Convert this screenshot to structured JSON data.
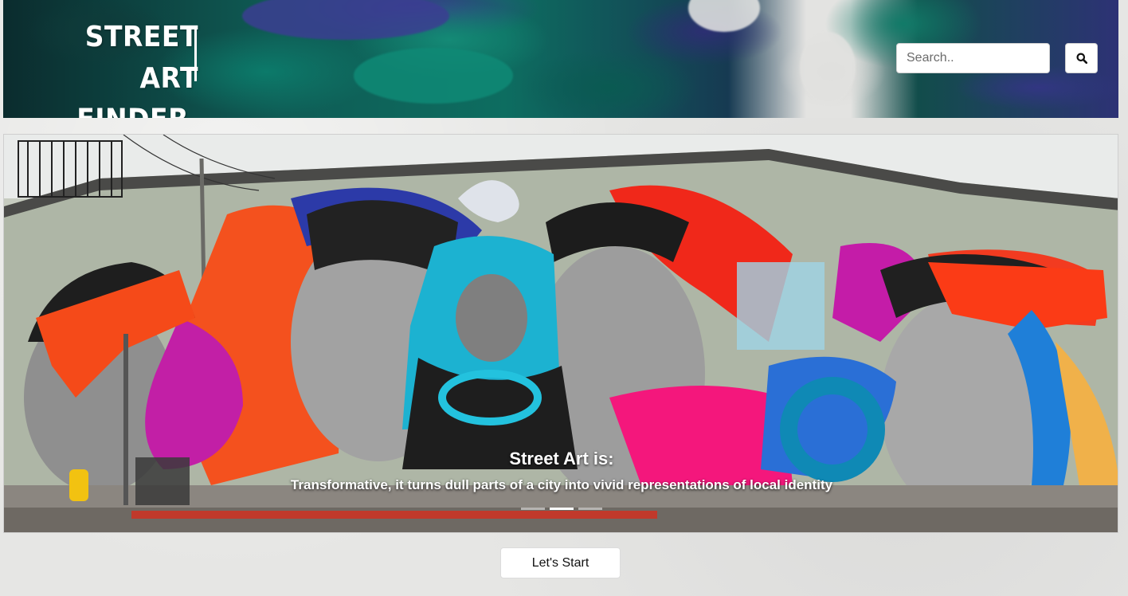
{
  "header": {
    "logo_line1": "STREET ART",
    "logo_line2": "FINDER",
    "search": {
      "placeholder": "Search.."
    },
    "search_icon": "search-icon"
  },
  "hero": {
    "caption_title": "Street Art is:",
    "caption_text": "Transformative, it turns dull parts of a city into vivid representations of local identity",
    "slides": 3,
    "active_slide": 1
  },
  "cta": {
    "label": "Let's Start"
  },
  "colors": {
    "header_teal": "#0d6d60",
    "header_indigo": "#2d3275",
    "page_background": "#e6e6e4",
    "mural_red": "#f2321f",
    "mural_cyan": "#1fb6d6",
    "mural_magenta": "#e0158a"
  }
}
